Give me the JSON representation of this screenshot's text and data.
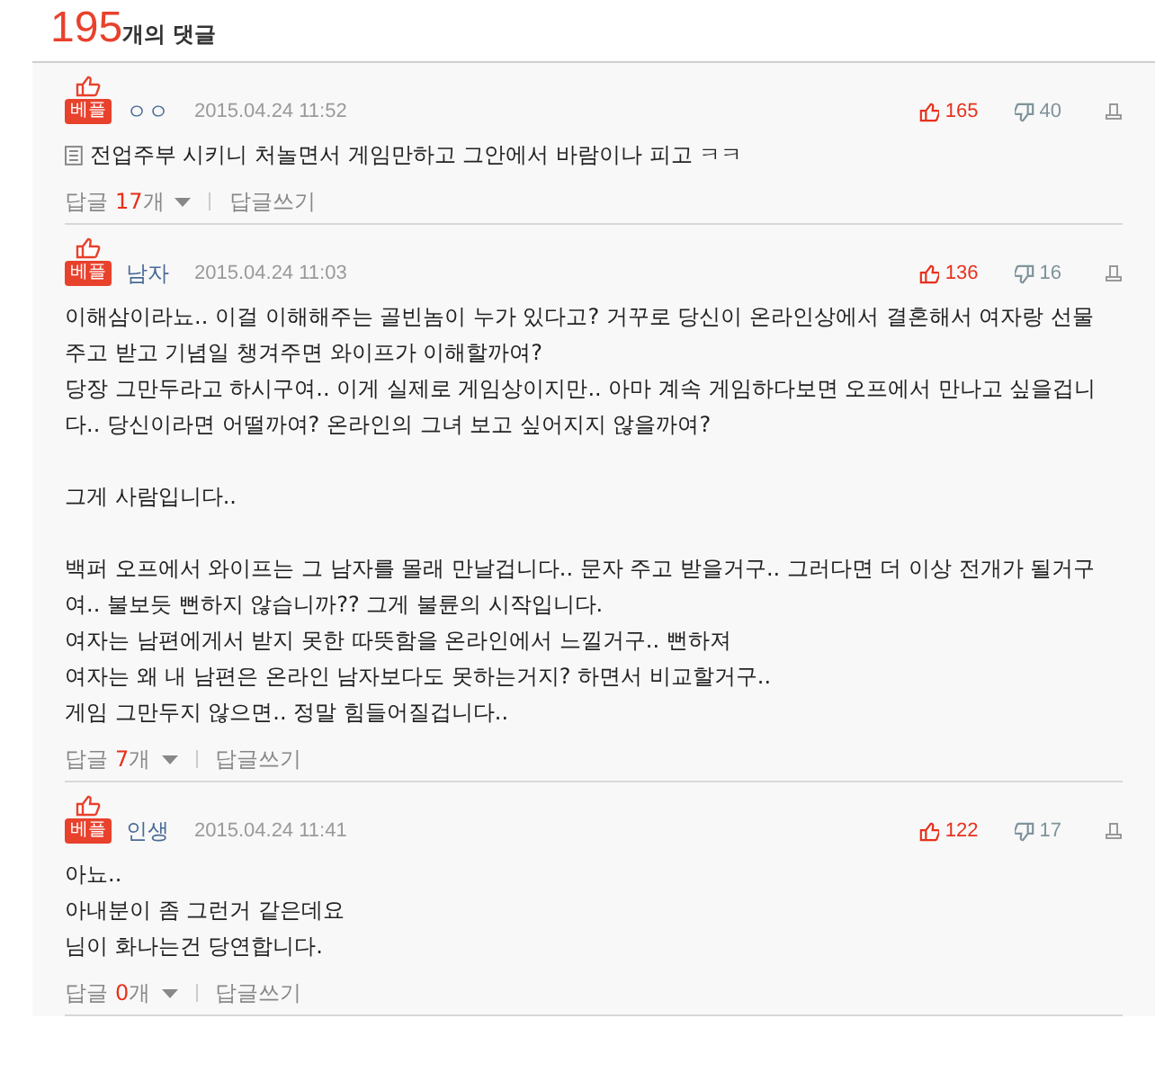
{
  "header": {
    "count": "195",
    "label": "개의 댓글"
  },
  "comments": [
    {
      "badge": "베플",
      "author": "ㅇㅇ",
      "date": "2015.04.24 11:52",
      "likes": "165",
      "dislikes": "40",
      "note_icon": true,
      "body": "전업주부 시키니 처놀면서 게임만하고 그안에서 바람이나 피고 ㅋㅋ",
      "reply_label": "답글",
      "reply_count": "17",
      "reply_unit": "개",
      "write": "답글쓰기"
    },
    {
      "badge": "베플",
      "author": "남자",
      "date": "2015.04.24 11:03",
      "likes": "136",
      "dislikes": "16",
      "note_icon": false,
      "body": "이해삼이라뇨.. 이걸 이해해주는 골빈놈이 누가 있다고? 거꾸로 당신이 온라인상에서 결혼해서 여자랑 선물주고 받고 기념일 챙겨주면 와이프가 이해할까여?\n당장 그만두라고 하시구여.. 이게 실제로 게임상이지만.. 아마 계속 게임하다보면 오프에서 만나고 싶을겁니다.. 당신이라면 어떨까여? 온라인의 그녀 보고 싶어지지 않을까여?\n\n그게 사람입니다..\n\n백퍼 오프에서 와이프는 그 남자를 몰래 만날겁니다.. 문자 주고 받을거구.. 그러다면 더 이상 전개가 될거구여.. 불보듯 뻔하지 않습니까?? 그게 불륜의 시작입니다.\n여자는 남편에게서 받지 못한 따뜻함을 온라인에서 느낄거구.. 뻔하져\n여자는 왜 내 남편은 온라인 남자보다도 못하는거지? 하면서 비교할거구..\n게임 그만두지 않으면.. 정말 힘들어질겁니다..",
      "reply_label": "답글",
      "reply_count": "7",
      "reply_unit": "개",
      "write": "답글쓰기"
    },
    {
      "badge": "베플",
      "author": "인생",
      "date": "2015.04.24 11:41",
      "likes": "122",
      "dislikes": "17",
      "note_icon": false,
      "body": "아뇨..\n아내분이 좀 그런거 같은데요\n님이 화나는건 당연합니다.",
      "reply_label": "답글",
      "reply_count": "0",
      "reply_unit": "개",
      "write": "답글쓰기"
    }
  ]
}
